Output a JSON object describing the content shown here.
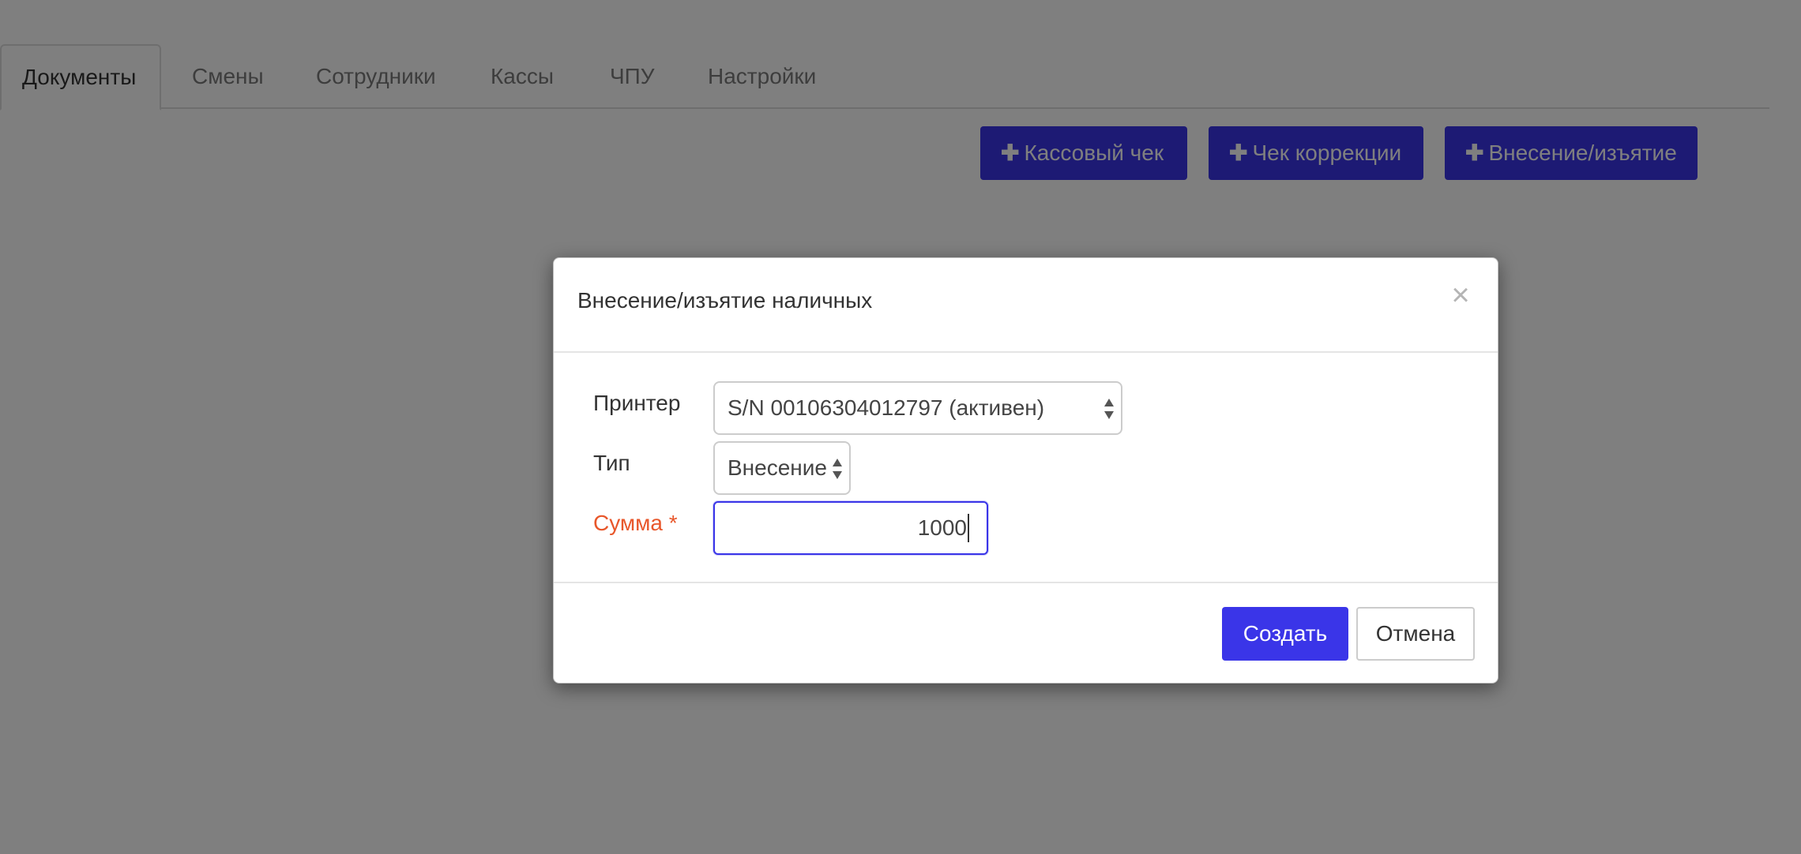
{
  "tabs": [
    {
      "label": "Документы",
      "active": true
    },
    {
      "label": "Смены"
    },
    {
      "label": "Сотрудники"
    },
    {
      "label": "Кассы"
    },
    {
      "label": "ЧПУ"
    },
    {
      "label": "Настройки"
    }
  ],
  "actions": {
    "receipt_label": "Кассовый чек",
    "correction_label": "Чек коррекции",
    "cash_in_out_label": "Внесение/изъятие",
    "plus_glyph": "✚"
  },
  "modal": {
    "title": "Внесение/изъятие наличных",
    "close_glyph": "×",
    "printer_label": "Принтер",
    "printer_value": "S/N 00106304012797 (активен)",
    "type_label": "Тип",
    "type_value": "Внесение",
    "amount_label": "Сумма *",
    "amount_value": "1000",
    "create_label": "Создать",
    "cancel_label": "Отмена"
  },
  "colors": {
    "accent": "#3a35e8",
    "required": "#e8572b",
    "overlay": "rgba(0,0,0,0.5)"
  },
  "icons": [
    "plus-icon",
    "close-icon",
    "select-arrows-icon"
  ]
}
